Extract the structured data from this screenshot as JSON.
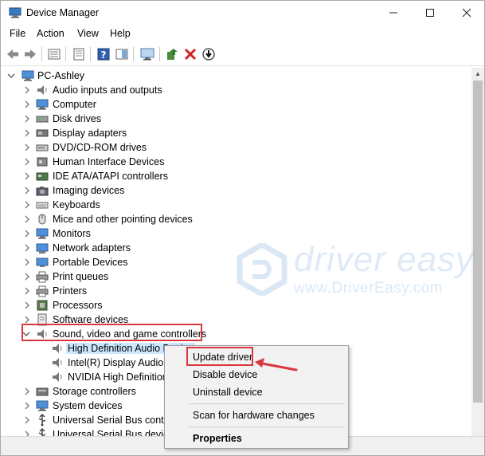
{
  "window": {
    "title": "Device Manager"
  },
  "menu": [
    "File",
    "Action",
    "View",
    "Help"
  ],
  "tree": {
    "root": "PC-Ashley",
    "categories": [
      {
        "label": "Audio inputs and outputs",
        "icon": "speaker-icon"
      },
      {
        "label": "Computer",
        "icon": "monitor-icon"
      },
      {
        "label": "Disk drives",
        "icon": "disk-drive-icon"
      },
      {
        "label": "Display adapters",
        "icon": "display-adapter-icon"
      },
      {
        "label": "DVD/CD-ROM drives",
        "icon": "dvd-drive-icon"
      },
      {
        "label": "Human Interface Devices",
        "icon": "hid-icon"
      },
      {
        "label": "IDE ATA/ATAPI controllers",
        "icon": "ide-controller-icon"
      },
      {
        "label": "Imaging devices",
        "icon": "camera-icon"
      },
      {
        "label": "Keyboards",
        "icon": "keyboard-icon"
      },
      {
        "label": "Mice and other pointing devices",
        "icon": "mouse-icon"
      },
      {
        "label": "Monitors",
        "icon": "monitor-icon"
      },
      {
        "label": "Network adapters",
        "icon": "network-adapter-icon"
      },
      {
        "label": "Portable Devices",
        "icon": "portable-device-icon"
      },
      {
        "label": "Print queues",
        "icon": "printer-icon"
      },
      {
        "label": "Printers",
        "icon": "printer-icon"
      },
      {
        "label": "Processors",
        "icon": "processor-icon"
      },
      {
        "label": "Software devices",
        "icon": "software-device-icon"
      },
      {
        "label": "Sound, video and game controllers",
        "icon": "speaker-icon"
      }
    ],
    "sound_children": [
      "High Definition Audio Device",
      "Intel(R) Display Audio",
      "NVIDIA High Definition Audio"
    ],
    "after": [
      {
        "label": "Storage controllers",
        "icon": "storage-controller-icon"
      },
      {
        "label": "System devices",
        "icon": "system-device-icon"
      },
      {
        "label": "Universal Serial Bus controllers",
        "icon": "usb-icon"
      },
      {
        "label": "Universal Serial Bus devices",
        "icon": "usb-icon"
      }
    ]
  },
  "context_menu": {
    "update": "Update driver",
    "disable": "Disable device",
    "uninstall": "Uninstall device",
    "scan": "Scan for hardware changes",
    "properties": "Properties"
  },
  "watermark": {
    "brand": "driver easy",
    "url": "www.DriverEasy.com"
  },
  "colors": {
    "highlight": "#d9363e",
    "selection": "#cce8ff",
    "watermark": "#468cd2"
  }
}
